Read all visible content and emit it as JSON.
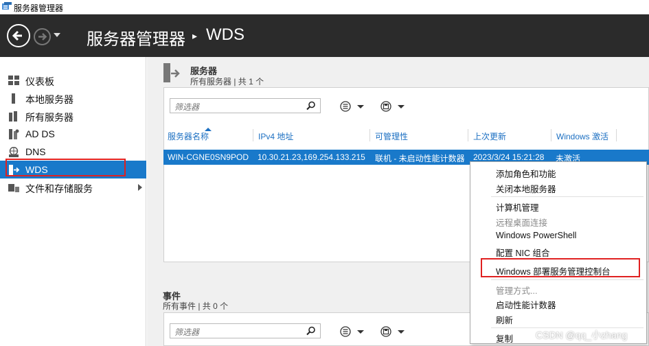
{
  "window": {
    "title": "服务器管理器"
  },
  "header": {
    "title": "服务器管理器",
    "separator": "▸",
    "current": "WDS"
  },
  "sidebar": {
    "items": [
      {
        "label": "仪表板",
        "icon": "dashboard-icon"
      },
      {
        "label": "本地服务器",
        "icon": "local-server-icon"
      },
      {
        "label": "所有服务器",
        "icon": "all-servers-icon"
      },
      {
        "label": "AD DS",
        "icon": "ad-ds-icon"
      },
      {
        "label": "DNS",
        "icon": "dns-icon"
      },
      {
        "label": "WDS",
        "icon": "wds-icon",
        "selected": true
      },
      {
        "label": "文件和存储服务",
        "icon": "file-storage-icon",
        "has_submenu": true
      }
    ]
  },
  "servers": {
    "title": "服务器",
    "subtitle": "所有服务器 | 共 1 个",
    "filter_placeholder": "筛选器",
    "columns": [
      "服务器名称",
      "IPv4 地址",
      "可管理性",
      "上次更新",
      "Windows 激活"
    ],
    "rows": [
      {
        "name": "WIN-CGNE0SN9POD",
        "ipv4": "10.30.21.23,169.254.133.215",
        "manageability": "联机 - 未启动性能计数器",
        "last_update": "2023/3/24 15:21:28",
        "activation": "未激活"
      }
    ]
  },
  "events": {
    "title": "事件",
    "subtitle": "所有事件 | 共 0 个",
    "filter_placeholder": "筛选器"
  },
  "context_menu": {
    "items": [
      {
        "label": "添加角色和功能",
        "disabled": false
      },
      {
        "label": "关闭本地服务器",
        "disabled": false
      },
      {
        "label": "计算机管理",
        "disabled": false
      },
      {
        "label": "远程桌面连接",
        "disabled": true
      },
      {
        "label": "Windows PowerShell",
        "disabled": false
      },
      {
        "label": "配置 NIC 组合",
        "disabled": false
      },
      {
        "label": "Windows 部署服务管理控制台",
        "disabled": false,
        "highlighted": true
      },
      {
        "label": "管理方式...",
        "disabled": true
      },
      {
        "label": "启动性能计数器",
        "disabled": false
      },
      {
        "label": "刷新",
        "disabled": false
      },
      {
        "label": "复制",
        "disabled": false
      }
    ]
  },
  "watermark": "CSDN @qq_小zhang",
  "colors": {
    "header_bg": "#2b2b2b",
    "selection": "#1979ca",
    "highlight_box": "#e02020",
    "link": "#1b6fc2"
  }
}
